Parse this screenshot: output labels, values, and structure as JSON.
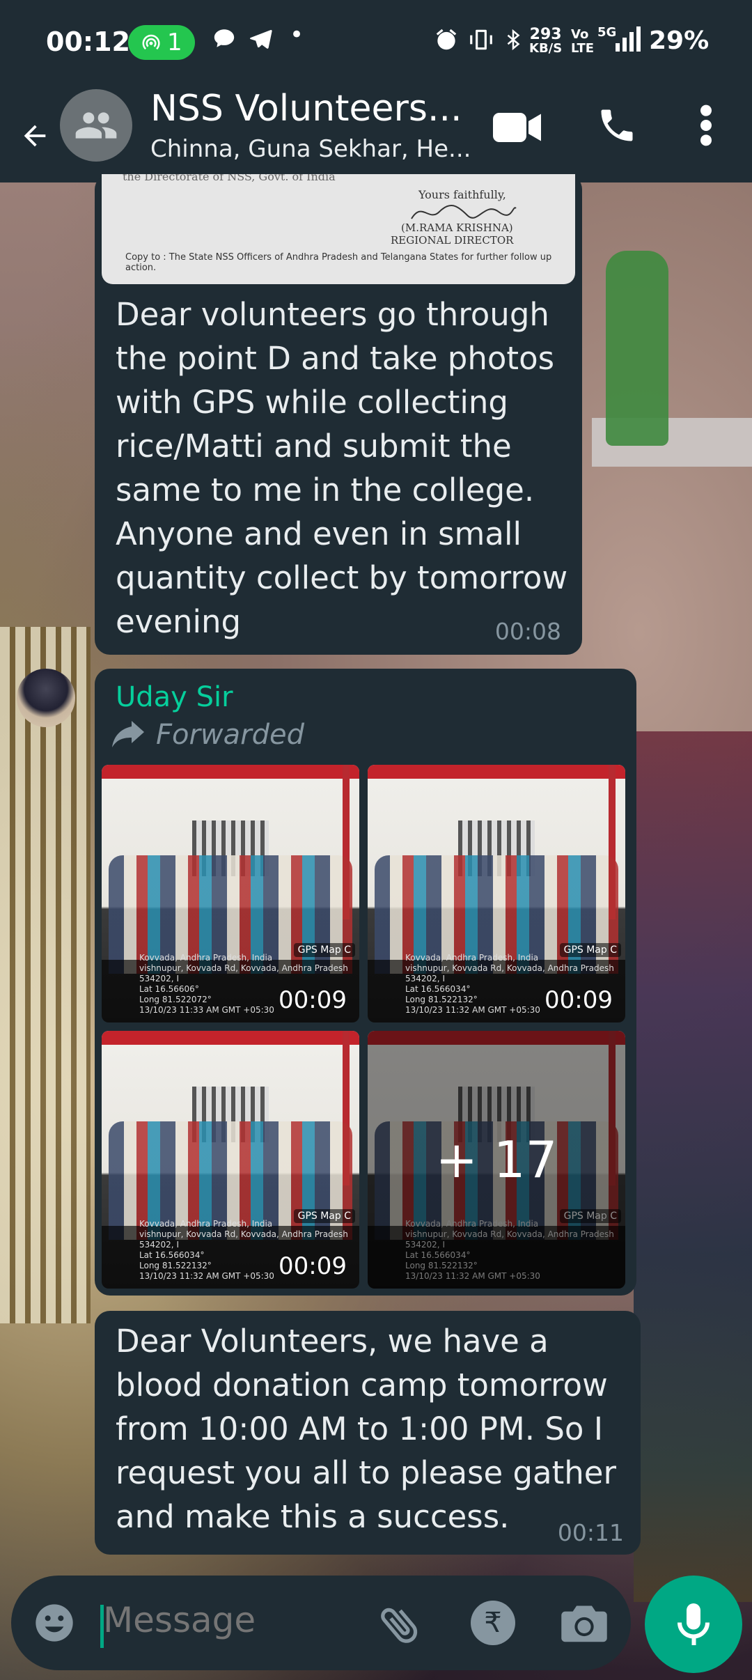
{
  "status_bar": {
    "time": "00:12",
    "hotspot_count": "1",
    "net_speed_value": "293",
    "net_speed_unit": "KB/S",
    "volte": "Vo LTE",
    "network": "5G",
    "battery": "29%"
  },
  "header": {
    "title": "NSS Volunteers...",
    "subtitle": "Chinna, Guna Sekhar, He..."
  },
  "messages": [
    {
      "document": {
        "signoff": "Yours faithfully,",
        "name": "(M.RAMA KRISHNA)",
        "role": "REGIONAL DIRECTOR",
        "copy_to": "Copy to : The State NSS Officers of Andhra Pradesh and Telangana States for further follow up action.",
        "top_fragment": "the Directorate of NSS, Govt. of India"
      },
      "text": "Dear volunteers go through the point D and take photos with GPS  while collecting rice/Matti and submit the same to me in the college. Anyone and even in small quantity collect by tomorrow evening",
      "time": "00:08"
    },
    {
      "sender": "Uday Sir",
      "forwarded_label": "Forwarded",
      "photos": [
        {
          "gps_tag": "GPS Map C",
          "gps_lines": [
            "Kovvada, Andhra Pradesh, India",
            "vishnupur, Kovvada Rd, Kovvada, Andhra Pradesh 534202, I",
            "Lat 16.56606°",
            "Long 81.522072°",
            "13/10/23 11:33 AM GMT +05:30"
          ],
          "time": "00:09"
        },
        {
          "gps_tag": "GPS Map C",
          "gps_lines": [
            "Kovvada, Andhra Pradesh, India",
            "vishnupur, Kovvada Rd, Kovvada, Andhra Pradesh 534202, I",
            "Lat 16.566034°",
            "Long 81.522132°",
            "13/10/23 11:32 AM GMT +05:30"
          ],
          "time": "00:09"
        },
        {
          "gps_tag": "GPS Map C",
          "gps_lines": [
            "Kovvada, Andhra Pradesh, India",
            "vishnupur, Kovvada Rd, Kovvada, Andhra Pradesh 534202, I",
            "Lat 16.566034°",
            "Long 81.522132°",
            "13/10/23 11:32 AM GMT +05:30"
          ],
          "time": "00:09"
        },
        {
          "gps_tag": "GPS Map C",
          "gps_lines": [
            "Kovvada, Andhra Pradesh, India",
            "vishnupur, Kovvada Rd, Kovvada, Andhra Pradesh 534202, I",
            "Lat 16.566034°",
            "Long 81.522132°",
            "13/10/23 11:32 AM GMT +05:30"
          ],
          "overlay": "+ 17"
        }
      ]
    },
    {
      "text": "Dear Volunteers, we have a blood donation camp tomorrow from 10:00 AM to 1:00 PM. So I request you all to please gather and make this a success.",
      "time": "00:11"
    }
  ],
  "composer": {
    "placeholder": "Message"
  },
  "colors": {
    "bar": "#1f2c34",
    "bubble": "#1f2c34",
    "accent": "#00a884",
    "sender_name": "#06cf9c",
    "meta": "#8696a0"
  }
}
